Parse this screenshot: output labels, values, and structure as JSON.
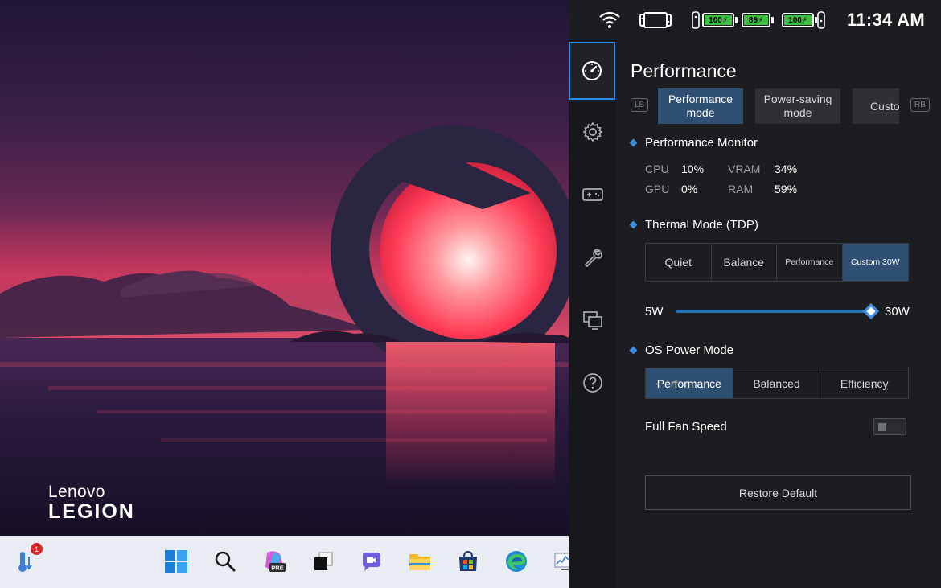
{
  "colors": {
    "accent": "#3a8de0",
    "active_tab": "#2f4f72",
    "panel_bg": "#1c1d20",
    "battery_green": "#3fbf3f",
    "taskbar_bg": "#e9ecf2"
  },
  "wallpaper": {
    "brand_top": "Lenovo",
    "brand_bottom": "LEGION"
  },
  "taskbar": {
    "items": [
      {
        "icon": "thermometer-icon",
        "badge": "1"
      },
      {
        "icon": "windows-start-icon"
      },
      {
        "icon": "search-icon"
      },
      {
        "icon": "copilot-pre-icon",
        "label": "PRE"
      },
      {
        "icon": "task-view-icon"
      },
      {
        "icon": "teams-chat-icon"
      },
      {
        "icon": "file-explorer-icon"
      },
      {
        "icon": "microsoft-store-icon"
      },
      {
        "icon": "edge-browser-icon"
      },
      {
        "icon": "performance-monitor-icon"
      }
    ]
  },
  "status": {
    "time": "11:34 AM",
    "batteries": [
      {
        "name": "left-controller",
        "level": "100"
      },
      {
        "name": "device",
        "level": "89"
      },
      {
        "name": "right-controller",
        "level": "100"
      }
    ]
  },
  "nav": {
    "items": [
      {
        "icon": "speedometer-icon",
        "active": true
      },
      {
        "icon": "gear-icon"
      },
      {
        "icon": "gamepad-icon"
      },
      {
        "icon": "wrench-icon"
      },
      {
        "icon": "display-icon"
      },
      {
        "icon": "help-icon"
      }
    ]
  },
  "page": {
    "title": "Performance",
    "lb": "LB",
    "rb": "RB",
    "mode_tabs": [
      {
        "label": "Performance mode",
        "active": true
      },
      {
        "label": "Power-saving mode",
        "active": false
      },
      {
        "label": "Custom",
        "active": false
      }
    ]
  },
  "monitor": {
    "heading": "Performance Monitor",
    "cpu_label": "CPU",
    "cpu_value": "10%",
    "vram_label": "VRAM",
    "vram_value": "34%",
    "gpu_label": "GPU",
    "gpu_value": "0%",
    "ram_label": "RAM",
    "ram_value": "59%"
  },
  "thermal": {
    "heading": "Thermal Mode (TDP)",
    "options": [
      "Quiet",
      "Balance",
      "Performance",
      "Custom 30W"
    ],
    "selected": "Custom 30W",
    "slider_min_label": "5W",
    "slider_max_label": "30W",
    "slider_min": 5,
    "slider_max": 30,
    "slider_value": 30
  },
  "os_power": {
    "heading": "OS Power Mode",
    "options": [
      "Performance",
      "Balanced",
      "Efficiency"
    ],
    "selected": "Performance"
  },
  "fan": {
    "label": "Full Fan Speed",
    "enabled": false
  },
  "restore_label": "Restore Default"
}
